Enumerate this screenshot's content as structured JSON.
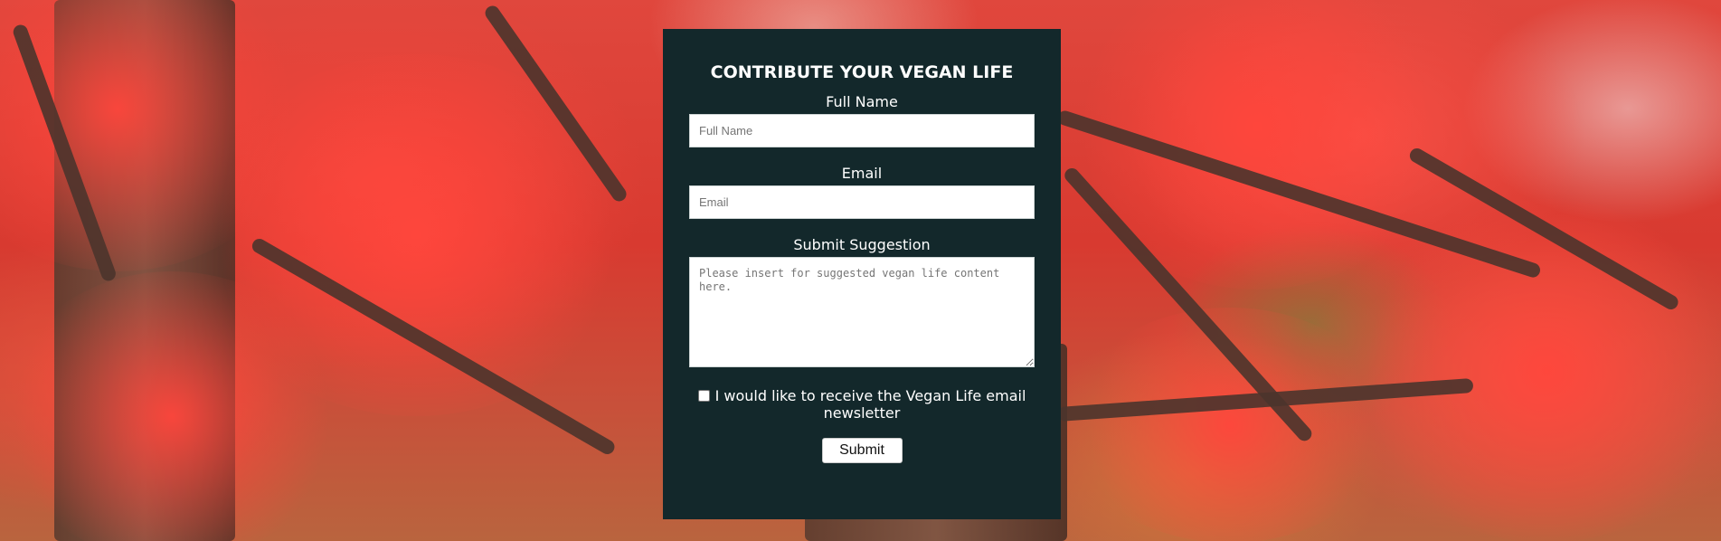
{
  "form": {
    "title": "CONTRIBUTE YOUR VEGAN LIFE",
    "full_name": {
      "label": "Full Name",
      "placeholder": "Full Name",
      "value": ""
    },
    "email": {
      "label": "Email",
      "placeholder": "Email",
      "value": ""
    },
    "suggestion": {
      "label": "Submit Suggestion",
      "placeholder": "Please insert for suggested vegan life content here.",
      "value": ""
    },
    "newsletter": {
      "label": "I would like to receive the Vegan Life email newsletter",
      "checked": false
    },
    "submit_label": "Submit"
  },
  "colors": {
    "panel_background": "#13282b",
    "text": "#ffffff",
    "background_accent": "#e0473d"
  }
}
